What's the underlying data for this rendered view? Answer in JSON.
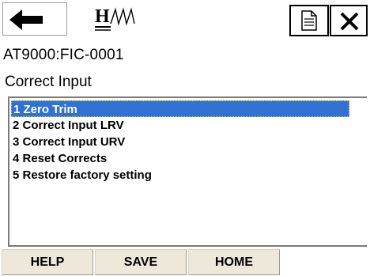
{
  "header": {
    "back_icon": "left-arrow-icon",
    "logo_icon": "hart-logo-icon",
    "document_icon": "document-icon",
    "close_icon": "close-x-icon"
  },
  "device_tag": "AT9000:FIC-0001",
  "menu": {
    "title": "Correct Input",
    "items": [
      {
        "label": "1 Zero Trim",
        "selected": true
      },
      {
        "label": "2 Correct Input LRV",
        "selected": false
      },
      {
        "label": "3 Correct Input URV",
        "selected": false
      },
      {
        "label": "4 Reset Corrects",
        "selected": false
      },
      {
        "label": "5 Restore factory setting",
        "selected": false
      }
    ]
  },
  "function_keys": {
    "help": "HELP",
    "save": "SAVE",
    "home": "HOME"
  },
  "colors": {
    "selection": "#3171d1",
    "function_key_bg": "#ede8da"
  }
}
